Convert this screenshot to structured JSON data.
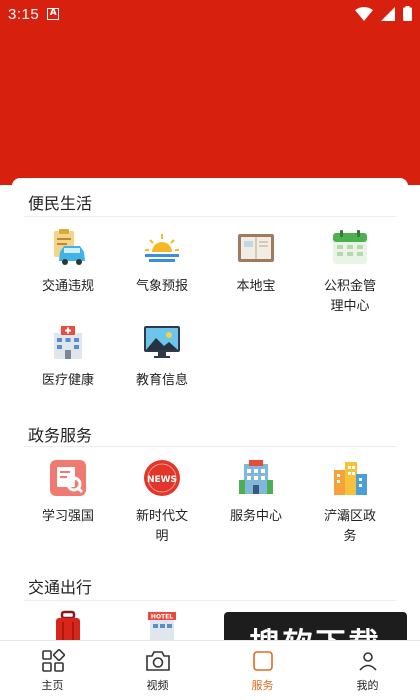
{
  "status_bar": {
    "time": "3:15"
  },
  "sections": [
    {
      "title": "便民生活",
      "items": [
        {
          "label": "交通违规",
          "icon": "car-clipboard-icon"
        },
        {
          "label": "气象预报",
          "icon": "sunrise-icon"
        },
        {
          "label": "本地宝",
          "icon": "notebook-icon"
        },
        {
          "label": "公积金管理中心",
          "icon": "calendar-icon"
        },
        {
          "label": "医疗健康",
          "icon": "hospital-icon"
        },
        {
          "label": "教育信息",
          "icon": "monitor-landscape-icon"
        }
      ]
    },
    {
      "title": "政务服务",
      "items": [
        {
          "label": "学习强国",
          "icon": "magnifier-document-icon"
        },
        {
          "label": "新时代文明",
          "icon": "news-icon"
        },
        {
          "label": "服务中心",
          "icon": "building-icon"
        },
        {
          "label": "浐灞区政务",
          "icon": "city-buildings-icon"
        }
      ]
    },
    {
      "title": "交通出行",
      "items": [
        {
          "label": "",
          "icon": "luggage-icon"
        },
        {
          "label": "",
          "icon": "hotel-icon",
          "icon_text": "HOTEL"
        }
      ]
    }
  ],
  "tabbar": [
    {
      "label": "主页",
      "icon": "grid-home-icon"
    },
    {
      "label": "视频",
      "icon": "camera-icon"
    },
    {
      "label": "服务",
      "icon": "service-icon",
      "active": true
    },
    {
      "label": "我的",
      "icon": "profile-icon"
    }
  ],
  "watermark": "搜软下载",
  "colors": {
    "header_red": "#d8200f",
    "active_tab": "#e06a1a"
  }
}
